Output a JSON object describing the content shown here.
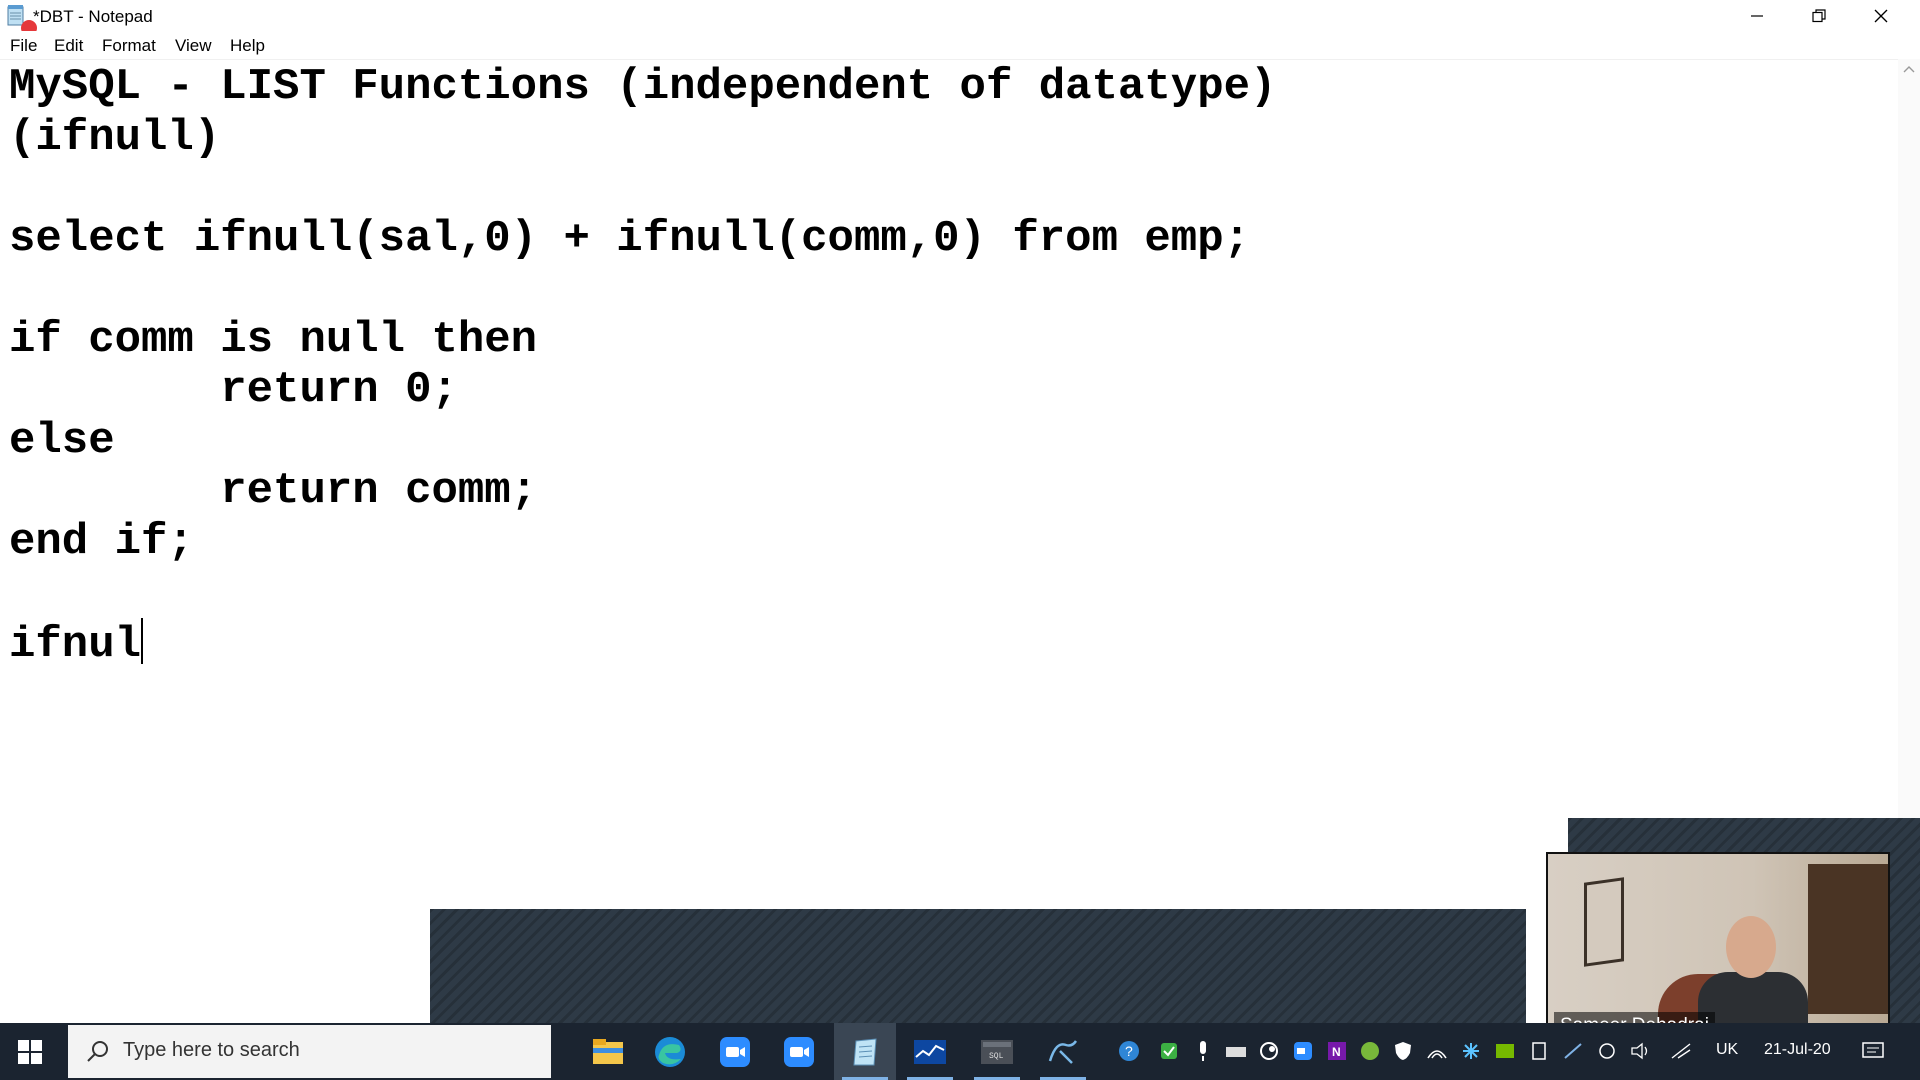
{
  "window": {
    "title": "*DBT - Notepad",
    "controls": {
      "minimize": "minimize",
      "restore": "restore",
      "close": "close"
    }
  },
  "menu": {
    "items": [
      {
        "label": "File"
      },
      {
        "label": "Edit"
      },
      {
        "label": "Format"
      },
      {
        "label": "View"
      },
      {
        "label": "Help"
      }
    ]
  },
  "editor": {
    "lines": [
      "MySQL - LIST Functions (independent of datatype)",
      "(ifnull)",
      "",
      "select ifnull(sal,0) + ifnull(comm,0) from emp;",
      "",
      "if comm is null then",
      "        return 0;",
      "else",
      "        return comm;",
      "end if;",
      ""
    ],
    "current_line": "ifnul"
  },
  "video": {
    "participant_name": "Sameer Dehadrai"
  },
  "taskbar": {
    "search_placeholder": "Type here to search",
    "apps": [
      {
        "icon": "file-explorer-icon"
      },
      {
        "icon": "edge-icon"
      },
      {
        "icon": "zoom-icon"
      },
      {
        "icon": "zoom-meetings-icon"
      },
      {
        "icon": "notepad-icon",
        "active": true
      },
      {
        "icon": "chart-app-icon"
      },
      {
        "icon": "sql-terminal-icon"
      },
      {
        "icon": "mysql-workbench-icon"
      }
    ],
    "tray": {
      "language": "UK",
      "date": "21-Jul-20"
    }
  },
  "colors": {
    "taskbar_bg": "#1b2430",
    "share_bar_bg": "#2e3a46",
    "record_dot": "#e5383b"
  }
}
